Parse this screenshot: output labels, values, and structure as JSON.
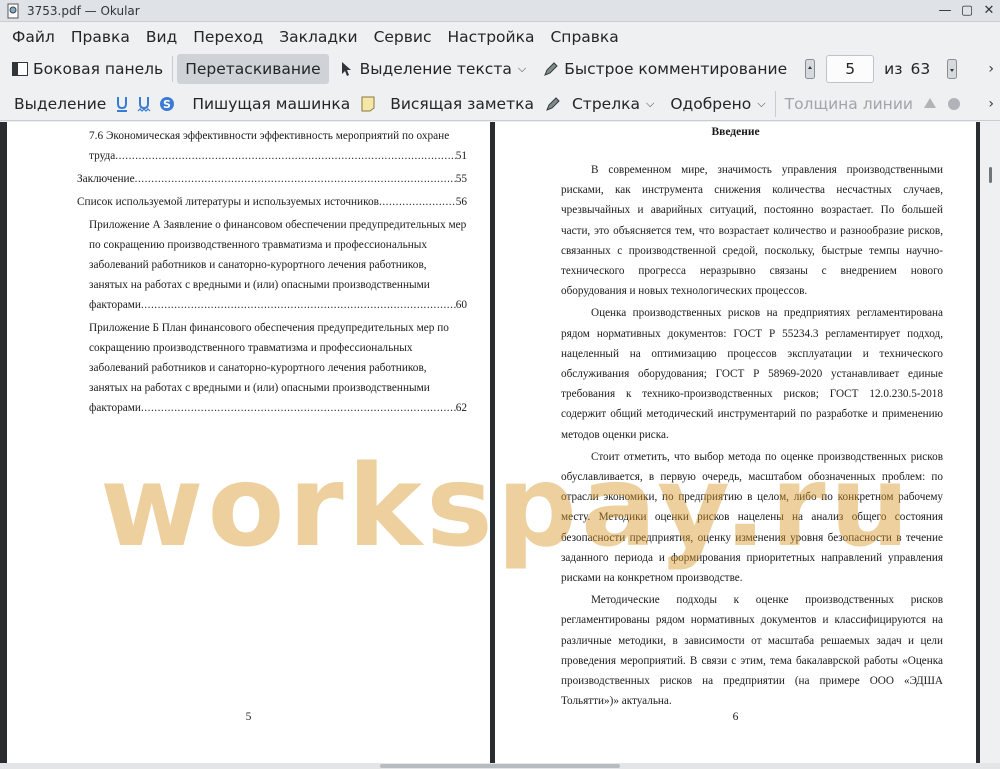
{
  "window": {
    "title": "3753.pdf  — Okular"
  },
  "menu": [
    "Файл",
    "Правка",
    "Вид",
    "Переход",
    "Закладки",
    "Сервис",
    "Настройка",
    "Справка"
  ],
  "toolbar1": {
    "sidebar": "Боковая панель",
    "drag": "Перетаскивание",
    "text_select": "Выделение текста",
    "quick_annot": "Быстрое комментирование",
    "page_current": "5",
    "page_of": "из",
    "page_total": "63"
  },
  "toolbar2": {
    "highlight": "Выделение",
    "typewriter": "Пишущая машинка",
    "note": "Висящая заметка",
    "arrow": "Стрелка",
    "stamp": "Одобрено",
    "line_width": "Толщина линии"
  },
  "left_page": {
    "toc": [
      {
        "text": "7.6 Экономическая эффективности эффективность мероприятий по охране",
        "last": "труда",
        "page": "51",
        "indent": true
      },
      {
        "text": "",
        "last": "Заключение",
        "page": "55",
        "indent": false
      },
      {
        "text": "",
        "last": "Список используемой литературы и используемых источников",
        "page": "56",
        "indent": false
      },
      {
        "text": "Приложение А Заявление о финансовом обеспечении предупредительных мер по сокращению производственного травматизма и профессиональных заболеваний работников и санаторно-курортного лечения работников, занятых на работах с вредными и (или) опасными производственными",
        "last": "факторами",
        "page": "60",
        "indent": true
      },
      {
        "text": "Приложение Б План финансового обеспечения предупредительных мер по сокращению производственного травматизма и профессиональных заболеваний работников и санаторно-курортного лечения работников, занятых на работах с вредными и (или) опасными производственными",
        "last": "факторами",
        "page": "62",
        "indent": true
      }
    ],
    "page_number": "5"
  },
  "right_page": {
    "title": "Введение",
    "paragraphs": [
      "В современном мире, значимость управления производственными рисками, как инструмента снижения количества несчастных случаев, чрезвычайных и аварийных ситуаций, постоянно возрастает. По большей части, это объясняется тем, что возрастает количество и разнообразие рисков, связанных с производственной средой, поскольку, быстрые темпы научно-технического прогресса неразрывно связаны с внедрением нового оборудования и новых технологических процессов.",
      "Оценка производственных рисков на предприятиях регламентирована рядом нормативных документов: ГОСТ Р 55234.3 регламентирует подход, нацеленный на оптимизацию процессов эксплуатации и технического обслуживания оборудования; ГОСТ Р 58969-2020 устанавливает единые требования к технико-производственных рисков; ГОСТ 12.0.230.5-2018 содержит общий методический инструментарий по разработке и применению методов оценки риска.",
      "Стоит отметить, что выбор метода по оценке производственных рисков обуславливается, в первую очередь, масштабом обозначенных проблем: по отрасли экономики, по предприятию в целом, либо по конкретном рабочему месту. Методики оценки рисков нацелены на анализ общего состояния безопасности предприятия, оценку изменения уровня безопасности в течение заданного периода и формирования приоритетных направлений управления рисками на конкретном производстве.",
      "Методические подходы к оценке производственных рисков регламентированы рядом нормативных документов и классифицируются на различные методики, в зависимости от масштаба решаемых задач и цели проведения мероприятий. В связи с этим, тема бакалаврской работы «Оценка производственных рисков на предприятии (на примере ООО «ЭДША Тольятти»)» актуальна."
    ],
    "page_number": "6"
  },
  "watermark": "workspay.ru"
}
